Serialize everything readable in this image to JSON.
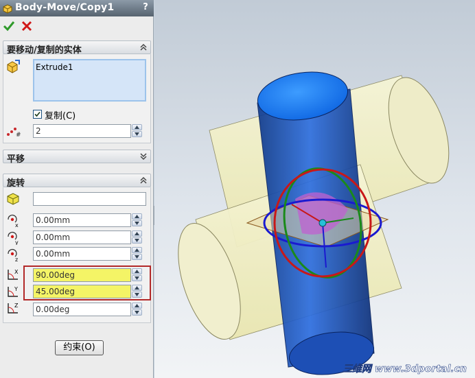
{
  "window": {
    "title": "Body-Move/Copy1",
    "help_label": "?"
  },
  "actions": {
    "ok_icon": "checkmark-icon",
    "cancel_icon": "x-icon"
  },
  "bodies_group": {
    "title": "要移动/复制的实体",
    "selected_bodies": [
      "Extrude1"
    ],
    "copy_checkbox": {
      "label": "复制(C)",
      "checked": true
    },
    "copy_count": "2"
  },
  "translate_group": {
    "title": "平移",
    "expanded": false
  },
  "rotate_group": {
    "title": "旋转",
    "rotation_reference": "",
    "origin_x": "0.00mm",
    "origin_y": "0.00mm",
    "origin_z": "0.00mm",
    "angle_x": "90.00deg",
    "angle_y": "45.00deg",
    "angle_z": "0.00deg"
  },
  "close_button": {
    "label": "约束(O)"
  },
  "viewport": {
    "watermark": "三维网 www.3dportal.cn"
  },
  "colors": {
    "highlight_field": "#f4f466",
    "highlight_border": "#b22828",
    "cylinder_blue": "#1f5fd0",
    "cylinder_yellow": "#f2f0c0"
  }
}
